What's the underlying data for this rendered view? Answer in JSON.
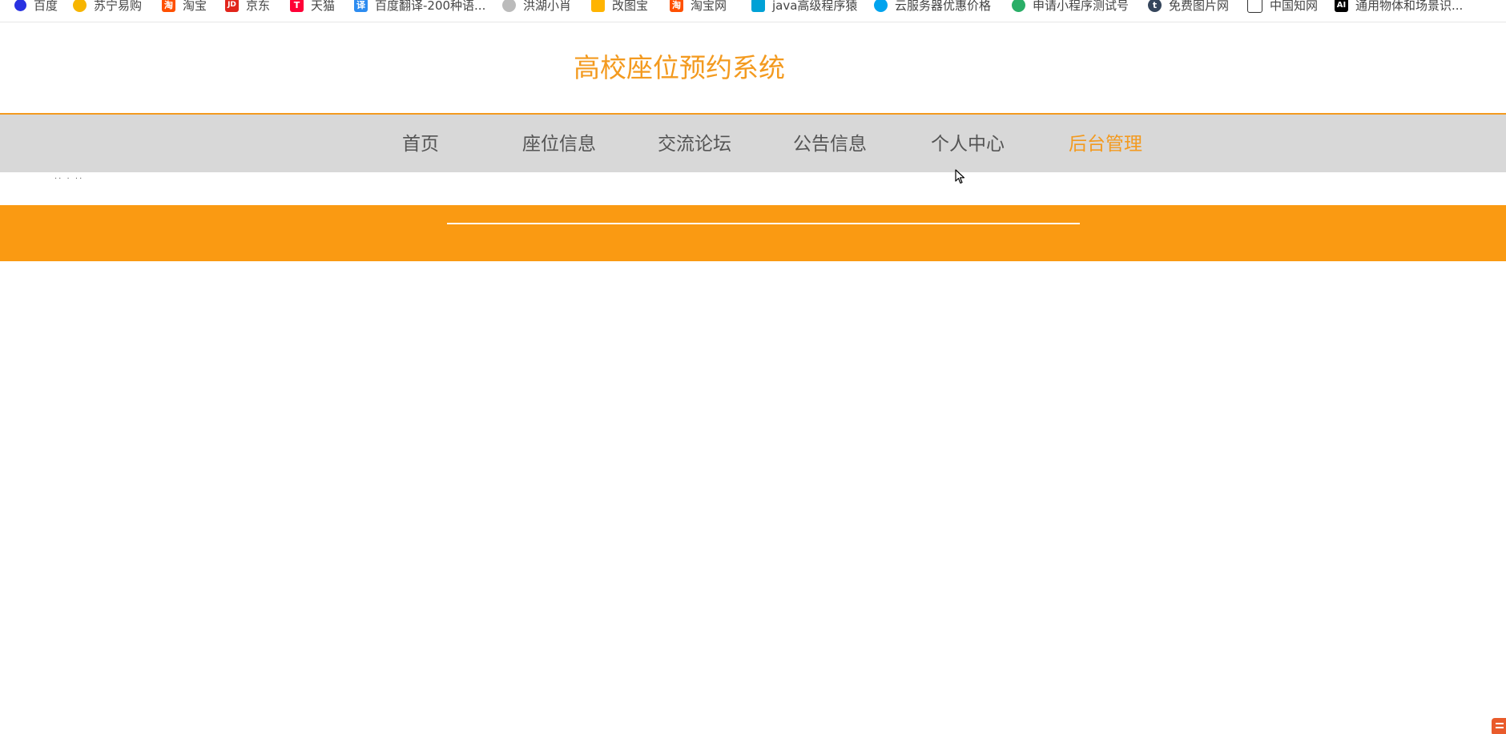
{
  "bookmarks": [
    {
      "label": "百度",
      "icon": "baidu-paw-icon",
      "color": "#2932e1"
    },
    {
      "label": "苏宁易购",
      "icon": "suning-icon",
      "color": "#f7b500"
    },
    {
      "label": "淘宝",
      "icon": "taobao-icon",
      "color": "#ff5000"
    },
    {
      "label": "京东",
      "icon": "jd-icon",
      "color": "#e1251b"
    },
    {
      "label": "天猫",
      "icon": "tmall-icon",
      "color": "#ff0036"
    },
    {
      "label": "百度翻译-200种语...",
      "icon": "translate-icon",
      "color": "#2d8cf0"
    },
    {
      "label": "洪湖小肖",
      "icon": "bird-icon",
      "color": "#888888"
    },
    {
      "label": "改图宝",
      "icon": "gaitubao-icon",
      "color": "#ffb400"
    },
    {
      "label": "淘宝网",
      "icon": "taobao-icon",
      "color": "#ff5000"
    },
    {
      "label": "java高级程序猿",
      "icon": "bilibili-icon",
      "color": "#00a1d6"
    },
    {
      "label": "云服务器优惠价格",
      "icon": "cloud-icon",
      "color": "#00a3ee"
    },
    {
      "label": "申请小程序测试号",
      "icon": "wechat-icon",
      "color": "#2aae67"
    },
    {
      "label": "免费图片网",
      "icon": "tumblr-icon",
      "color": "#35465c"
    },
    {
      "label": "中国知网",
      "icon": "cnki-icon",
      "color": "#333333"
    },
    {
      "label": "通用物体和场景识...",
      "icon": "ai-icon",
      "color": "#000000"
    }
  ],
  "site": {
    "title": "高校座位预约系统"
  },
  "nav": {
    "items": [
      {
        "label": "首页",
        "active": false
      },
      {
        "label": "座位信息",
        "active": false
      },
      {
        "label": "交流论坛",
        "active": false
      },
      {
        "label": "公告信息",
        "active": false
      },
      {
        "label": "个人中心",
        "active": false
      },
      {
        "label": "后台管理",
        "active": true
      }
    ]
  },
  "breadcrumb_dots": "·· · ··",
  "colors": {
    "accent": "#f39a1f",
    "banner": "#fa9a12",
    "nav_bg": "#d8d8d8"
  }
}
